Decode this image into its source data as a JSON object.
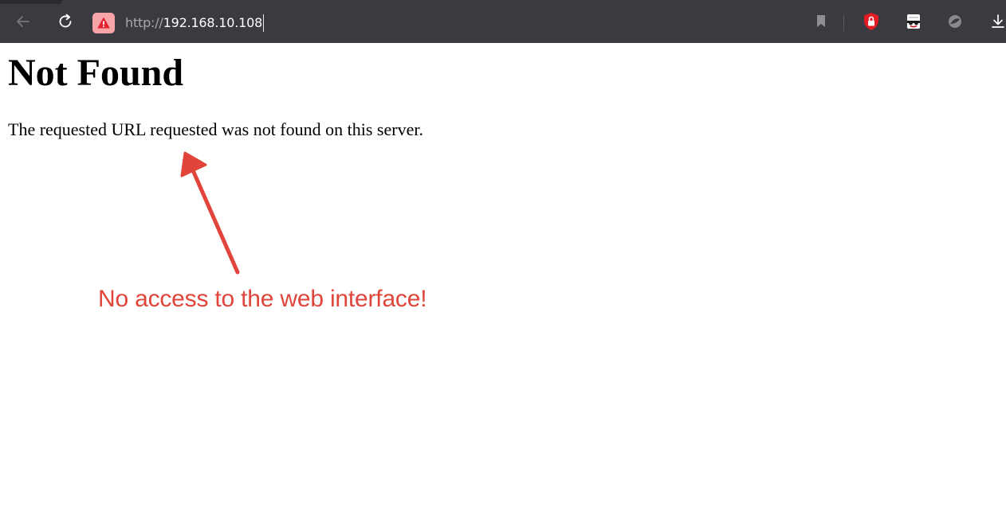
{
  "browser": {
    "address_bar": {
      "scheme": "http://",
      "host": "192.168.10.108",
      "security_state": "warning-icon"
    },
    "buttons": {
      "back": "back-arrow-icon",
      "reload": "reload-icon",
      "bookmark": "bookmark-icon",
      "extensions": [
        "shield-lock-icon",
        "incognito-mask-icon",
        "leaf-icon"
      ],
      "downloads": "download-icon"
    },
    "colors": {
      "toolbar_bg": "#3b3a40",
      "warning_bg": "#f8a5a9",
      "warning_fg": "#e0212e",
      "annotation": "#e0443a"
    }
  },
  "page": {
    "title": "Not Found",
    "message": "The requested URL requested was not found on this server."
  },
  "annotation": {
    "text": "No access to the web interface!"
  }
}
